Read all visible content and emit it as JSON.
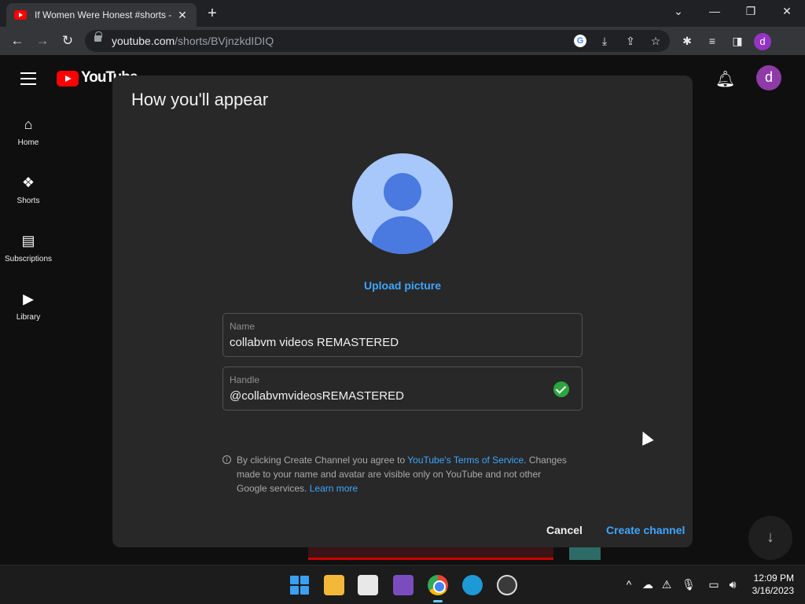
{
  "browser": {
    "tab_title": "If Women Were Honest #shorts -",
    "tab_close": "✕",
    "new_tab": "+",
    "window_controls": [
      "⌄",
      "—",
      "❐",
      "✕"
    ],
    "url_host": "youtube.com",
    "url_path": "/shorts/BVjnzkdIDIQ",
    "profile_letter": "d",
    "nav": {
      "back": "←",
      "forward": "→",
      "reload": "↻"
    }
  },
  "youtube": {
    "logo_text": "YouTube",
    "avatar_letter": "d",
    "sidebar": [
      {
        "label": "Home",
        "icon": "⌂"
      },
      {
        "label": "Shorts",
        "icon": "❖"
      },
      {
        "label": "Subscriptions",
        "icon": "▤"
      },
      {
        "label": "Library",
        "icon": "▶"
      }
    ]
  },
  "dialog": {
    "title": "How you'll appear",
    "upload_label": "Upload picture",
    "name_label": "Name",
    "name_value": "collabvm videos REMASTERED",
    "handle_label": "Handle",
    "handle_value": "@collabvmvideosREMASTERED",
    "info_prefix": "By clicking Create Channel you agree to ",
    "tos_link": "YouTube's Terms of Service",
    "info_suffix": ". Changes made to your name and avatar are visible only on YouTube and not other Google services. ",
    "learn_more": "Learn more",
    "cancel_label": "Cancel",
    "create_label": "Create channel"
  },
  "taskbar": {
    "time": "12:09 PM",
    "date": "3/16/2023"
  },
  "colors": {
    "accent": "#3ea6ff",
    "check": "#2ba640",
    "yt_red": "#ff0000"
  }
}
